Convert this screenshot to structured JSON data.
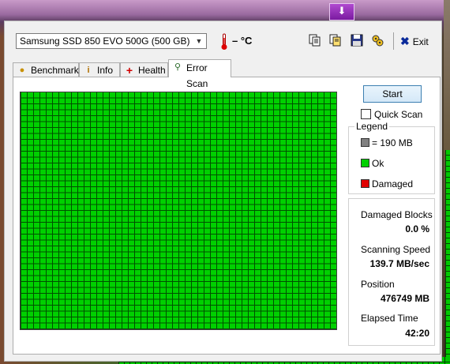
{
  "desktop": {
    "top_button_icon": "download-tray-icon"
  },
  "toolbar": {
    "drive_selected": "Samsung SSD 850 EVO 500G (500 GB)",
    "temperature": "– °C",
    "exit_label": "Exit"
  },
  "tabs": [
    {
      "label": "Benchmark",
      "icon": "lightbulb-icon"
    },
    {
      "label": "Info",
      "icon": "info-icon"
    },
    {
      "label": "Health",
      "icon": "health-cross-icon"
    },
    {
      "label": "Error Scan",
      "icon": "magnifier-icon",
      "active": true
    }
  ],
  "error_scan": {
    "start_label": "Start",
    "quick_scan_label": "Quick Scan",
    "quick_scan_checked": false,
    "legend": {
      "title": "Legend",
      "block_size": "= 190 MB",
      "ok": "Ok",
      "damaged": "Damaged"
    },
    "stats": {
      "damaged_blocks_label": "Damaged Blocks",
      "damaged_blocks_value": "0.0 %",
      "scanning_speed_label": "Scanning Speed",
      "scanning_speed_value": "139.7 MB/sec",
      "position_label": "Position",
      "position_value": "476749 MB",
      "elapsed_time_label": "Elapsed Time",
      "elapsed_time_value": "42:20"
    }
  },
  "colors": {
    "ok": "#00d000",
    "damaged": "#e00000",
    "block": "#808080"
  }
}
